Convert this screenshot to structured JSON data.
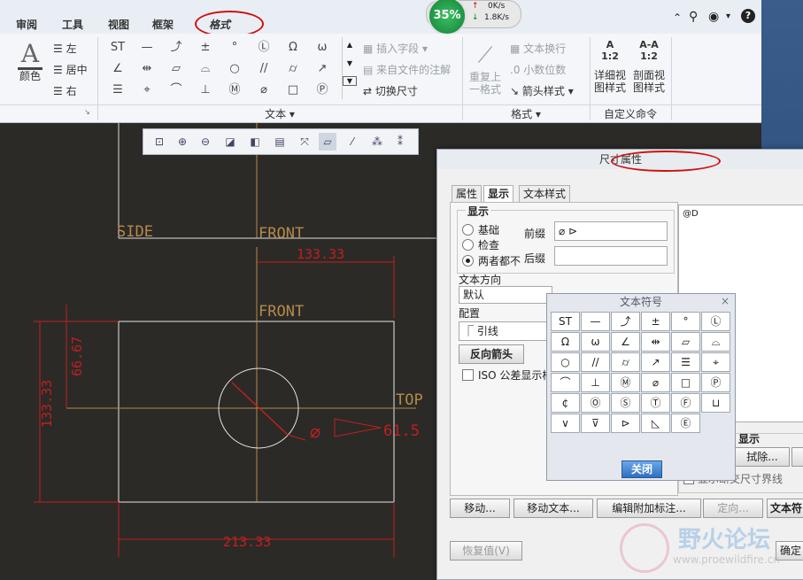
{
  "tabs": [
    "审阅",
    "工具",
    "视图",
    "框架",
    "格式"
  ],
  "cpu": {
    "percent": "35%",
    "up": "0K/s",
    "down": "1.8K/s"
  },
  "ribbon": {
    "color_label": "颜色",
    "align": [
      "左",
      "居中",
      "右"
    ],
    "insert_field": "插入字段",
    "from_file_note": "来自文件的注解",
    "toggle_dim": "切换尺寸",
    "repeat_format": [
      "重复上",
      "一格式"
    ],
    "text_wrap": "文本换行",
    "decimal": "小数位数",
    "arrow_style": "箭头样式",
    "detail_view": [
      "详细视",
      "图样式"
    ],
    "section_view": [
      "剖面视",
      "图样式"
    ],
    "ratio": "1:2",
    "group_text": "文本",
    "group_format": "格式",
    "group_custom": "自定义命令",
    "symbols": [
      "ST",
      "—",
      "⤴",
      "±",
      "°",
      "Ⓛ",
      "Ω",
      "ω",
      "∠",
      "⇹",
      "▱",
      "⌓",
      "○",
      "//",
      "⌭",
      "↗",
      "☰",
      "⌖",
      "⌒",
      "⊥",
      "Ⓜ",
      "⌀",
      "□",
      "Ⓟ"
    ]
  },
  "drawing": {
    "side": "SIDE",
    "front_top": "FRONT",
    "dim_top": "133.33",
    "front_mid": "FRONT",
    "top": "TOP",
    "dim_height": "133.33",
    "dim_inner": "66.67",
    "dim_bottom": "213.33",
    "dim_diam": "61.5"
  },
  "dialog": {
    "title": "尺寸属性",
    "tabs": [
      "属性",
      "显示",
      "文本样式"
    ],
    "display_group": "显示",
    "radios": [
      "基础",
      "检查",
      "两者都不"
    ],
    "prefix_label": "前缀",
    "prefix_value": "⌀ ⊳",
    "suffix_label": "后缀",
    "text_dir_label": "文本方向",
    "text_dir_value": "默认",
    "config_label": "配置",
    "leader_value": "引线",
    "reverse_arrow": "反向箭头",
    "iso_label": "ISO 公差显示样",
    "textarea": "@D",
    "display2": "显示",
    "erase": "拭除...",
    "dim_line": "显示断交尺寸界线",
    "move": "移动...",
    "move_text": "移动文本...",
    "edit_attach": "编辑附加标注...",
    "orient": "定向...",
    "text_sym": "文本符",
    "restore": "恢复值(V)",
    "ok": "确定"
  },
  "palette": {
    "title": "文本符号",
    "close": "关闭",
    "symbols": [
      "ST",
      "—",
      "⤴",
      "±",
      "°",
      "Ⓛ",
      "Ω",
      "ω",
      "∠",
      "⇹",
      "▱",
      "⌓",
      "○",
      "//",
      "⌭",
      "↗",
      "☰",
      "⌖",
      "⌒",
      "⊥",
      "Ⓜ",
      "⌀",
      "□",
      "Ⓟ",
      "¢",
      "Ⓞ",
      "Ⓢ",
      "Ⓣ",
      "Ⓕ",
      "⊔",
      "∨",
      "⊽",
      "⊳",
      "◺",
      "Ⓔ"
    ]
  },
  "watermark": {
    "name": "野火论坛",
    "url": "www.proewildfire.cn"
  }
}
